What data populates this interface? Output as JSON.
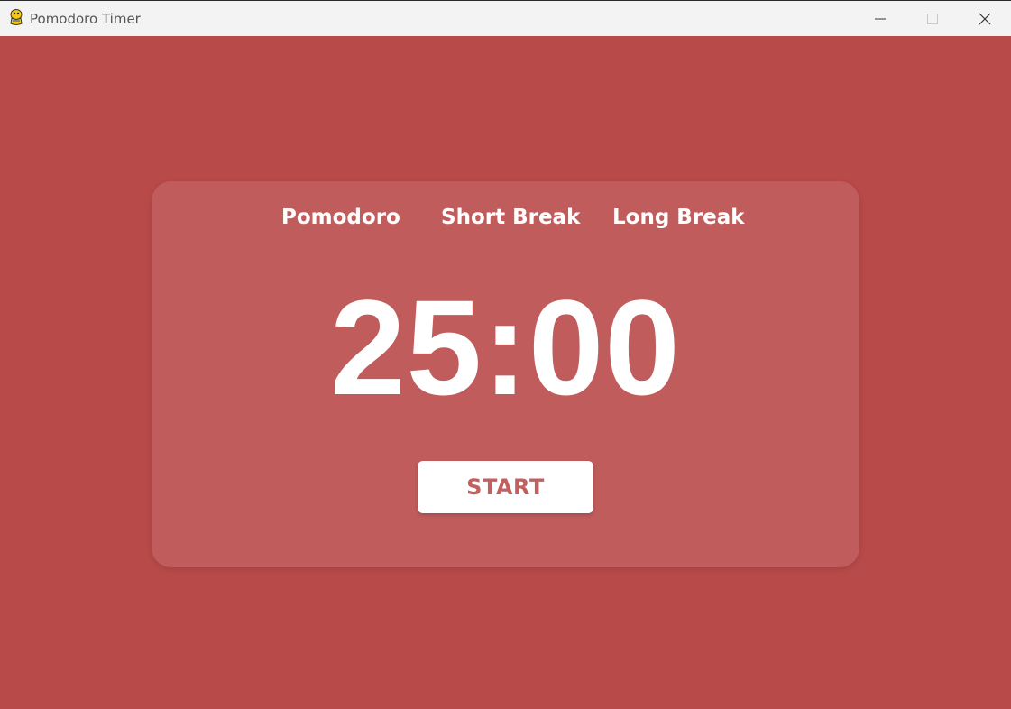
{
  "window": {
    "title": "Pomodoro Timer",
    "app_icon": "pygame-snake-icon",
    "controls": [
      "minimize-icon",
      "maximize-icon",
      "close-icon"
    ]
  },
  "tabs": [
    {
      "label": "Pomodoro"
    },
    {
      "label": "Short Break"
    },
    {
      "label": "Long Break"
    }
  ],
  "timer": {
    "display": "25:00"
  },
  "start_button": {
    "label": "START"
  },
  "colors": {
    "background": "#b94a4a",
    "card": "rgba(255,255,255,0.10)",
    "button_text": "#c26060",
    "text": "#ffffff"
  }
}
